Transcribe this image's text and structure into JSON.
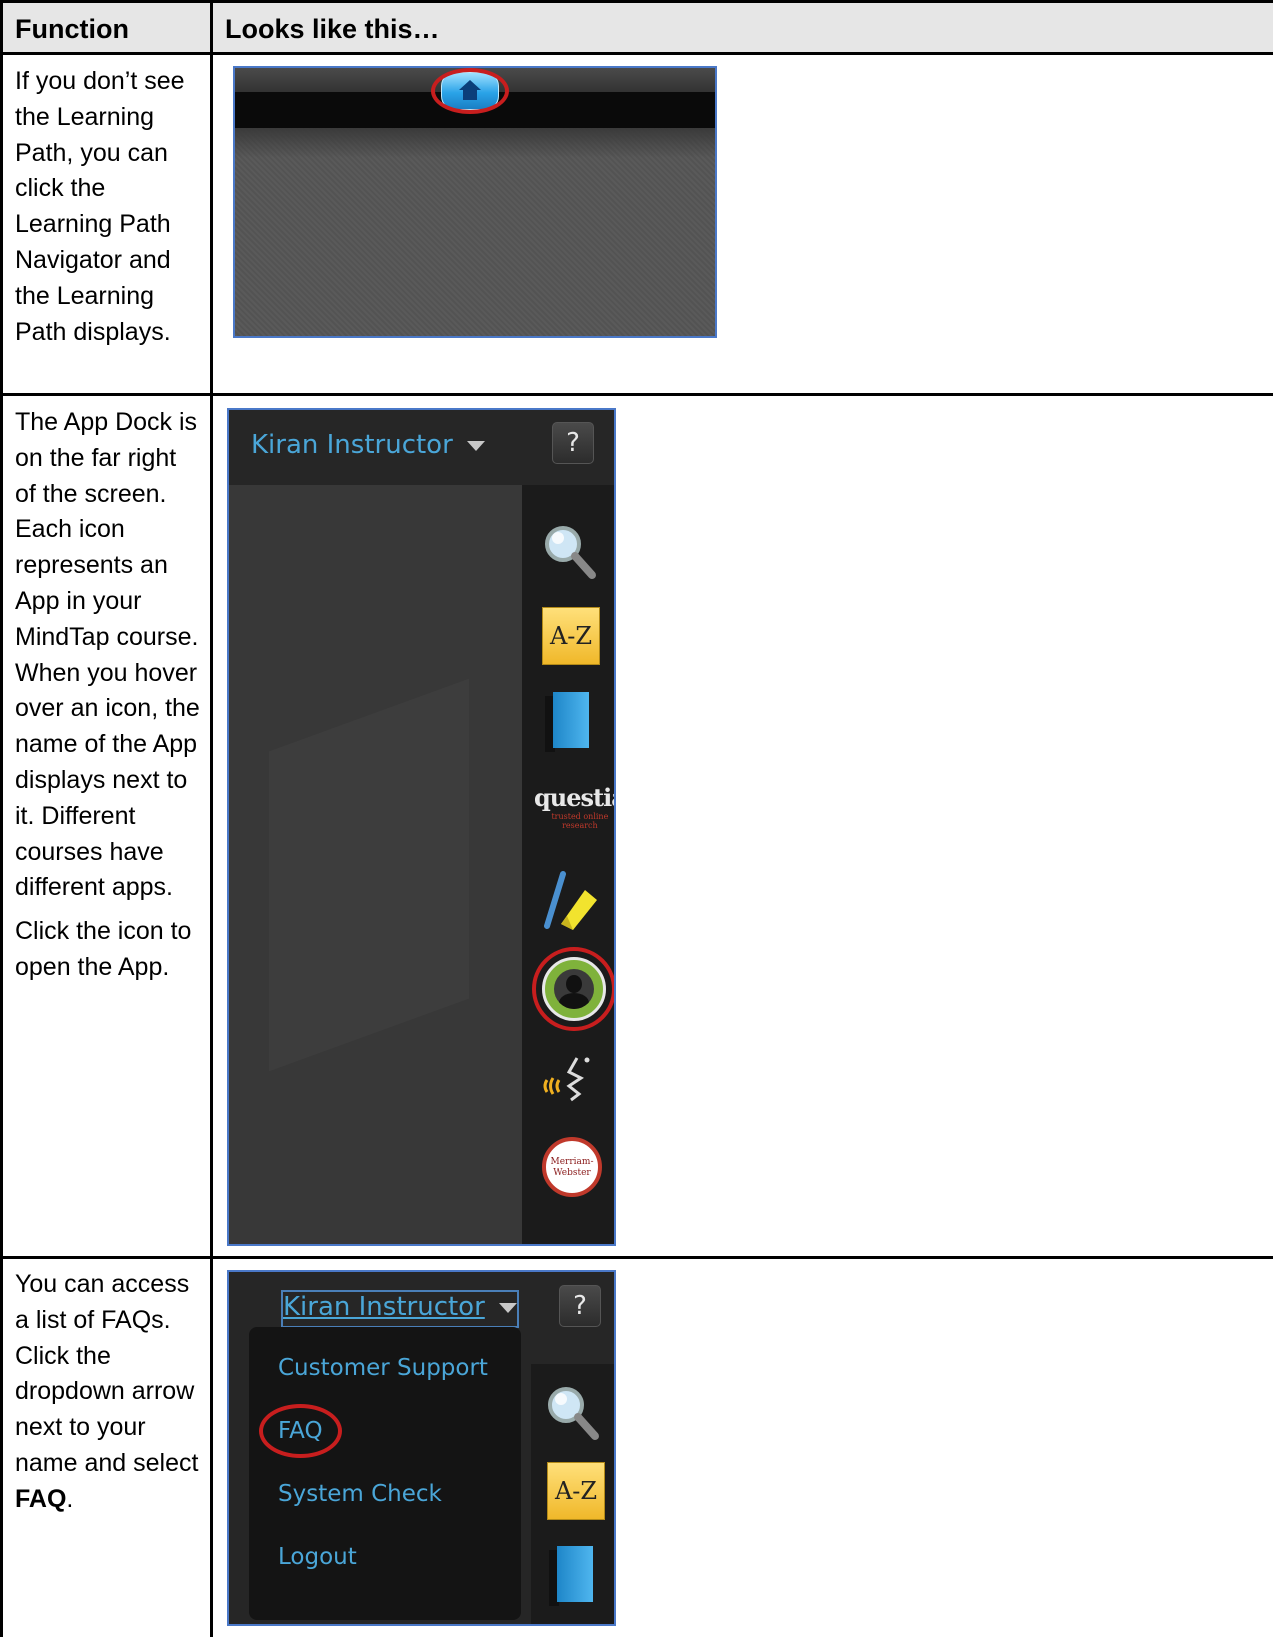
{
  "table": {
    "header": {
      "function": "Function",
      "looks_like": "Looks like this…"
    },
    "rows": [
      {
        "function_text": "If you don’t see the Learning Path, you can click the Learning Path Navigator and the Learning Path displays."
      },
      {
        "function_text": "The App Dock is on the far right of the screen. Each icon represents an App in your MindTap course. When you hover over an icon, the name of the App displays next to it. Different courses have different apps.",
        "function_text2": "Click the icon to open the App."
      },
      {
        "function_text_pre": "You can access a list of FAQs. Click the dropdown arrow next to your name and select ",
        "function_text_bold": "FAQ",
        "function_text_post": "."
      }
    ]
  },
  "screenshot_app_dock": {
    "user_name": "Kiran Instructor",
    "help_label": "?",
    "icons": [
      "search-icon",
      "a-z-icon",
      "book-icon",
      "questia-icon",
      "highlighter-icon",
      "avatar-icon",
      "speech-icon",
      "merriam-webster-icon"
    ],
    "az_label": "A-Z",
    "questia_label": "questia",
    "questia_tagline": "trusted online research",
    "mw_label_1": "Merriam-",
    "mw_label_2": "Webster"
  },
  "screenshot_menu": {
    "user_name": "Kiran Instructor",
    "help_label": "?",
    "menu_items": [
      "Customer Support",
      "FAQ",
      "System Check",
      "Logout"
    ],
    "az_label": "A-Z"
  },
  "colors": {
    "accent_blue": "#4aa6d8",
    "highlight_red": "#c81e1e",
    "header_gray": "#e6e6e6"
  }
}
